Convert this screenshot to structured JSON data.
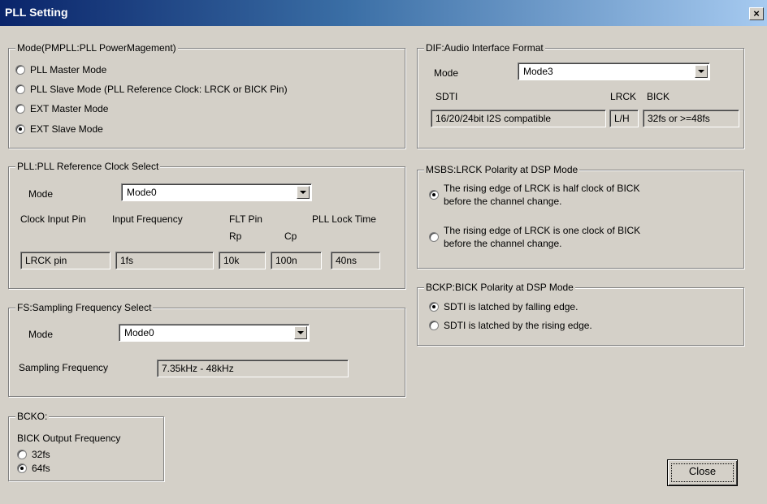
{
  "window": {
    "title": "PLL Setting",
    "close_glyph": "×"
  },
  "mode_group": {
    "legend": "Mode(PMPLL:PLL PowerMagement)",
    "options": [
      {
        "label": "PLL Master Mode",
        "selected": false
      },
      {
        "label": "PLL Slave Mode (PLL Reference Clock: LRCK or BICK Pin)",
        "selected": false
      },
      {
        "label": "EXT Master Mode",
        "selected": false
      },
      {
        "label": "EXT Slave Mode",
        "selected": true
      }
    ]
  },
  "pll_group": {
    "legend": "PLL:PLL Reference Clock Select",
    "mode_label": "Mode",
    "mode_value": "Mode0",
    "headers": {
      "clock_input_pin": "Clock Input Pin",
      "input_frequency": "Input Frequency",
      "flt_pin": "FLT Pin",
      "pll_lock_time": "PLL Lock Time",
      "rp": "Rp",
      "cp": "Cp"
    },
    "values": {
      "clock_input_pin": "LRCK pin",
      "input_frequency": "1fs",
      "rp": "10k",
      "cp": "100n",
      "pll_lock_time": "40ns"
    }
  },
  "fs_group": {
    "legend": "FS:Sampling Frequency Select",
    "mode_label": "Mode",
    "mode_value": "Mode0",
    "sampling_label": "Sampling Frequency",
    "sampling_value": "7.35kHz - 48kHz"
  },
  "bcko_group": {
    "legend": "BCKO:",
    "label": "BICK Output Frequency",
    "options": [
      {
        "label": "32fs",
        "selected": false
      },
      {
        "label": "64fs",
        "selected": true
      }
    ]
  },
  "dif_group": {
    "legend": "DIF:Audio Interface Format",
    "mode_label": "Mode",
    "mode_value": "Mode3",
    "headers": {
      "sdti": "SDTI",
      "lrck": "LRCK",
      "bick": "BICK"
    },
    "values": {
      "sdti": "16/20/24bit I2S compatible",
      "lrck": "L/H",
      "bick": "32fs or >=48fs"
    }
  },
  "msbs_group": {
    "legend": "MSBS:LRCK Polarity at DSP Mode",
    "options": [
      {
        "line1": "The rising edge of LRCK is half clock of BICK",
        "line2": "before the channel change.",
        "selected": true
      },
      {
        "line1": "The rising edge of LRCK is one clock of BICK",
        "line2": "before the channel change.",
        "selected": false
      }
    ]
  },
  "bckp_group": {
    "legend": "BCKP:BICK Polarity at DSP Mode",
    "options": [
      {
        "label": "SDTI is latched by falling edge.",
        "selected": true
      },
      {
        "label": "SDTI is latched by the rising edge.",
        "selected": false
      }
    ]
  },
  "footer": {
    "close_label": "Close"
  }
}
